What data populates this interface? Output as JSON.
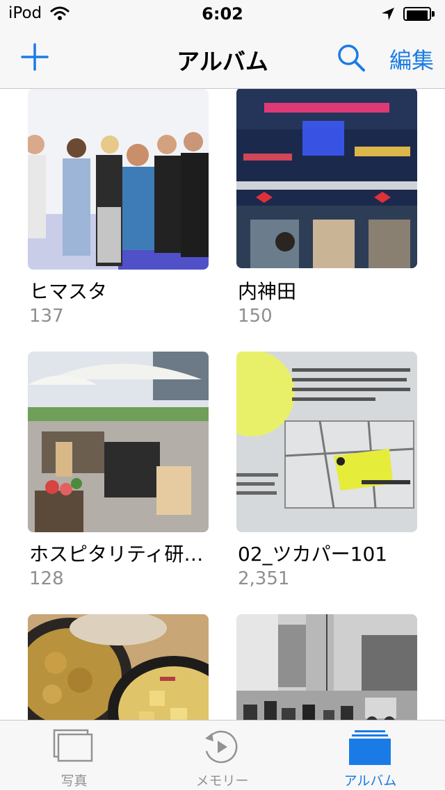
{
  "status_bar": {
    "carrier": "iPod",
    "time": "6:02"
  },
  "nav": {
    "title": "アルバム",
    "edit_label": "編集"
  },
  "albums": [
    {
      "title": "ヒマスタ",
      "count": "137"
    },
    {
      "title": "内神田",
      "count": "150"
    },
    {
      "title": "ホスピタリティ研…",
      "count": "128"
    },
    {
      "title": "02_ツカパー101",
      "count": "2,351"
    },
    {
      "title": "",
      "count": ""
    },
    {
      "title": "",
      "count": ""
    }
  ],
  "tabs": [
    {
      "label": "写真",
      "icon": "photos-icon",
      "active": false
    },
    {
      "label": "メモリー",
      "icon": "memories-icon",
      "active": false
    },
    {
      "label": "アルバム",
      "icon": "albums-icon",
      "active": true
    }
  ],
  "colors": {
    "accent": "#1a7be6",
    "inactive_tab": "#929292",
    "bar_bg": "#f7f7f7",
    "count_text": "#8e8e93"
  }
}
